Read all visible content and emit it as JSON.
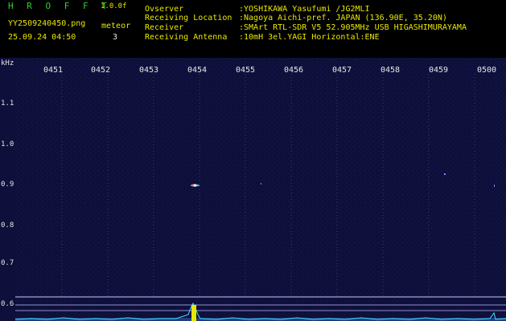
{
  "header": {
    "brand": "H R O F F T",
    "version": "1.0.0f",
    "filename": "YY2509240450.png",
    "datetime": "25.09.24 04:50",
    "meteor_label": "meteor",
    "meteor_count": "3",
    "info": [
      {
        "key": "Ovserver",
        "value": ":YOSHIKAWA Yasufumi /JG2MLI"
      },
      {
        "key": "Receiving Location",
        "value": ":Nagoya Aichi-pref. JAPAN (136.90E, 35.20N)"
      },
      {
        "key": "Receiver",
        "value": ":SMArt RTL-SDR V5 52.905MHz USB HIGASHIMURAYAMA"
      },
      {
        "key": "Receiving Antenna",
        "value": ":10mH 3el.YAGI Horizontal:ENE"
      }
    ]
  },
  "axis": {
    "unit": "kHz",
    "y_labels": [
      "1.1",
      "1.0",
      "0.9",
      "0.8",
      "0.7",
      "0.6"
    ],
    "time_ticks": [
      "0451",
      "0452",
      "0453",
      "0454",
      "0455",
      "0456",
      "0457",
      "0458",
      "0459",
      "0500"
    ]
  },
  "colors": {
    "background": "#0e0f3a",
    "header_green": "#33cc33",
    "header_yellow": "#e8e800",
    "text_white": "#e6e6e6"
  }
}
